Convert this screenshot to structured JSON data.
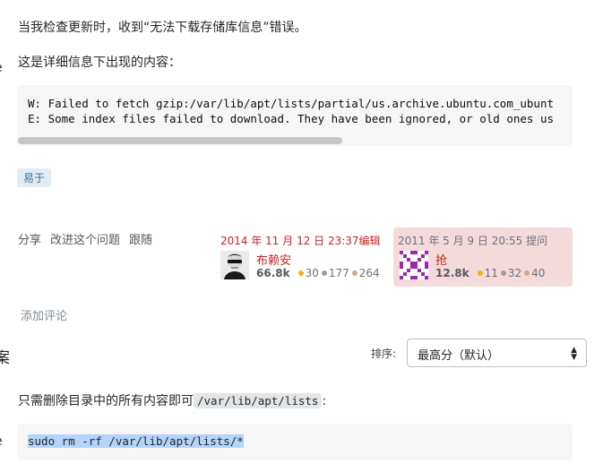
{
  "question": {
    "paragraph1": "当我检查更新时，收到“无法下载存储库信息”错误。",
    "paragraph2": "这是详细信息下出现的内容：",
    "edge_char_1": "e",
    "code_lines": [
      "W: Failed to fetch gzip:/var/lib/apt/lists/partial/us.archive.ubuntu.com_ubunt",
      "E: Some index files failed to download. They have been ignored, or old ones us"
    ],
    "tag": "易于",
    "menu": [
      "分享",
      "改进这个问题",
      "跟随"
    ],
    "edited": {
      "time": "2014 年 11 月 12 日 23:37编辑",
      "user": "布赖安",
      "rep": "66.8k",
      "gold": "30",
      "silver": "177",
      "bronze": "264"
    },
    "asked": {
      "time": "2011 年 5 月 9 日 20:55 提问",
      "user": "抢",
      "rep": "12.8k",
      "gold": "11",
      "silver": "32",
      "bronze": "40"
    },
    "add_comment": "添加评论"
  },
  "answers": {
    "heading": "案",
    "sort_label": "排序:",
    "sort_value": "最高分（默认）",
    "answer_text": "只需删除目录中的所有内容即可",
    "answer_code_inline": "/var/lib/apt/lists",
    "answer_text_suffix": ":",
    "edge_char_2": "e",
    "command": "sudo rm -rf /var/lib/apt/lists/*"
  },
  "colors": {
    "accent_red": "#d21f1f",
    "tag_bg": "#e1ecf4",
    "tag_text": "#39739d",
    "asked_bg": "#f5dadb",
    "selection": "#b3d4fc"
  }
}
